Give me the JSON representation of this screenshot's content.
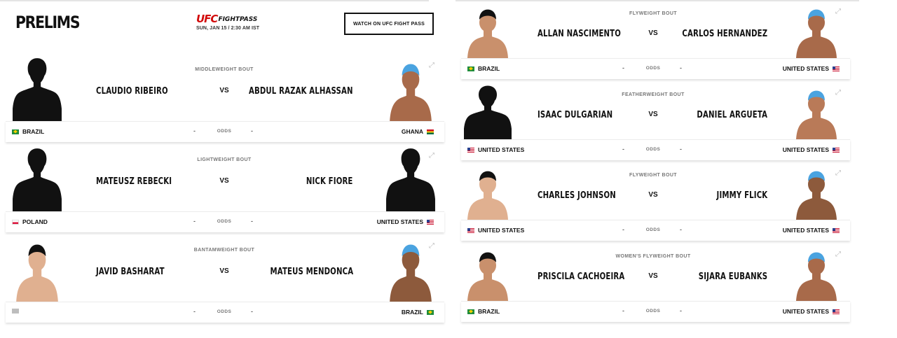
{
  "header": {
    "title": "PRELIMS",
    "brand": {
      "ufc": "UFC",
      "fight_pass": "FIGHTPASS",
      "date": "SUN, JAN 15 / 2:30 AM IST"
    },
    "watch_button": "WATCH ON UFC FIGHT PASS"
  },
  "labels": {
    "vs": "VS",
    "odds": "ODDS",
    "dash": "-"
  },
  "colors": {
    "brand_red": "#d20a0a",
    "text": "#111111",
    "muted": "#777777"
  },
  "bouts": [
    {
      "weight_class": "MIDDLEWEIGHT BOUT",
      "red": {
        "name": "CLAUDIO RIBEIRO",
        "country": "BRAZIL",
        "flag": "br",
        "photo": "silhouette"
      },
      "blue": {
        "name": "ABDUL RAZAK ALHASSAN",
        "country": "GHANA",
        "flag": "gh",
        "photo": "fighter-photo"
      }
    },
    {
      "weight_class": "LIGHTWEIGHT BOUT",
      "red": {
        "name": "MATEUSZ REBECKI",
        "country": "POLAND",
        "flag": "pl",
        "photo": "silhouette"
      },
      "blue": {
        "name": "NICK FIORE",
        "country": "UNITED STATES",
        "flag": "us",
        "photo": "silhouette"
      }
    },
    {
      "weight_class": "BANTAMWEIGHT BOUT",
      "red": {
        "name": "JAVID BASHARAT",
        "country": "",
        "flag": "unk",
        "photo": "fighter-photo"
      },
      "blue": {
        "name": "MATEUS MENDONCA",
        "country": "BRAZIL",
        "flag": "br",
        "photo": "fighter-photo"
      }
    },
    {
      "weight_class": "FLYWEIGHT BOUT",
      "red": {
        "name": "ALLAN NASCIMENTO",
        "country": "BRAZIL",
        "flag": "br",
        "photo": "fighter-photo"
      },
      "blue": {
        "name": "CARLOS HERNANDEZ",
        "country": "UNITED STATES",
        "flag": "us",
        "photo": "fighter-photo"
      }
    },
    {
      "weight_class": "FEATHERWEIGHT BOUT",
      "red": {
        "name": "ISAAC DULGARIAN",
        "country": "UNITED STATES",
        "flag": "us",
        "photo": "silhouette"
      },
      "blue": {
        "name": "DANIEL ARGUETA",
        "country": "UNITED STATES",
        "flag": "us",
        "photo": "fighter-photo"
      }
    },
    {
      "weight_class": "FLYWEIGHT BOUT",
      "red": {
        "name": "CHARLES JOHNSON",
        "country": "UNITED STATES",
        "flag": "us",
        "photo": "fighter-photo"
      },
      "blue": {
        "name": "JIMMY FLICK",
        "country": "UNITED STATES",
        "flag": "us",
        "photo": "fighter-photo"
      }
    },
    {
      "weight_class": "WOMEN'S FLYWEIGHT BOUT",
      "red": {
        "name": "PRISCILA CACHOEIRA",
        "country": "BRAZIL",
        "flag": "br",
        "photo": "fighter-photo"
      },
      "blue": {
        "name": "SIJARA EUBANKS",
        "country": "UNITED STATES",
        "flag": "us",
        "photo": "fighter-photo"
      }
    }
  ]
}
